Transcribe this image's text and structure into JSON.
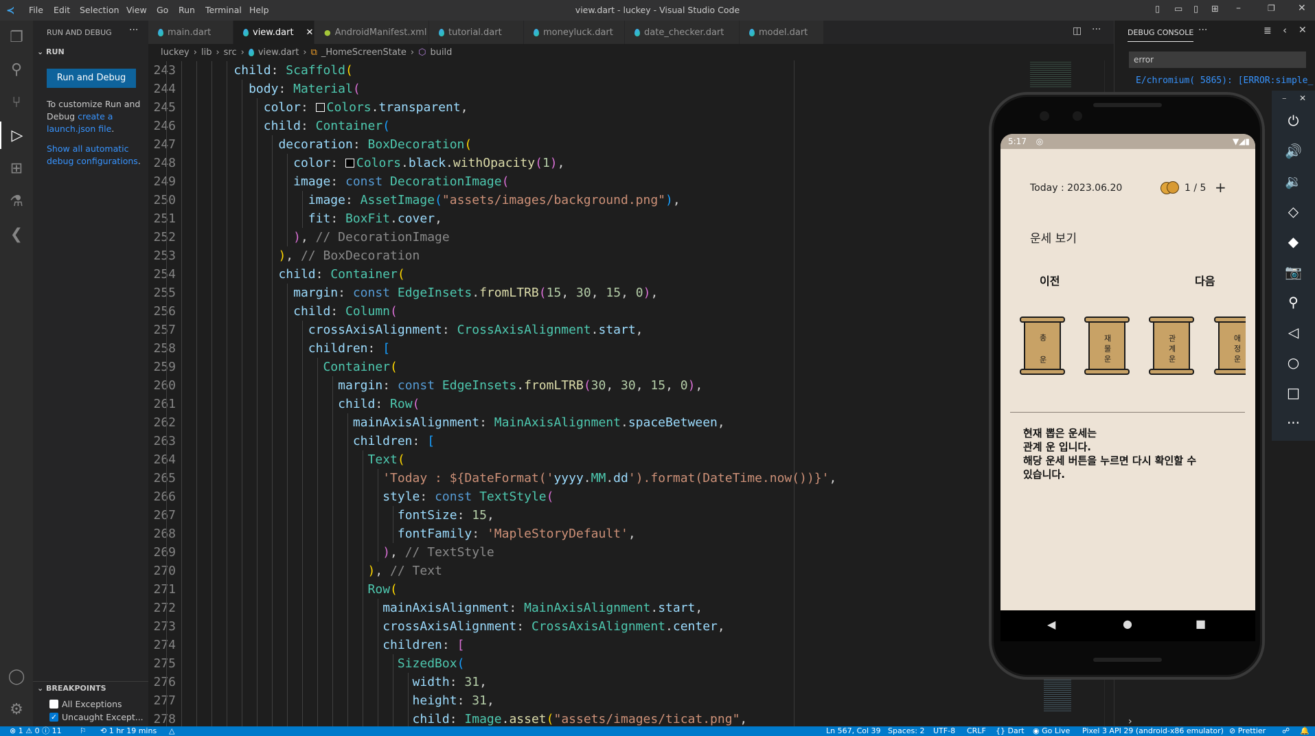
{
  "titlebar": {
    "menu": [
      "File",
      "Edit",
      "Selection",
      "View",
      "Go",
      "Run",
      "Terminal",
      "Help"
    ],
    "title": "view.dart - luckey - Visual Studio Code"
  },
  "sidebar": {
    "header": "RUN AND DEBUG",
    "section": "RUN",
    "run_button": "Run and Debug",
    "help_text": "To customize Run and Debug",
    "help_link": "create a launch.json file",
    "help_period": ".",
    "show_all_link": "Show all automatic debug configurations",
    "show_all_period": ".",
    "breakpoints_header": "BREAKPOINTS",
    "breakpoints": [
      {
        "label": "All Exceptions",
        "checked": false
      },
      {
        "label": "Uncaught Except...",
        "checked": true
      }
    ]
  },
  "tabs": [
    {
      "label": "main.dart",
      "icon": "dart"
    },
    {
      "label": "view.dart",
      "icon": "dart",
      "active": true
    },
    {
      "label": "AndroidManifest.xml",
      "icon": "android"
    },
    {
      "label": "tutorial.dart",
      "icon": "dart"
    },
    {
      "label": "moneyluck.dart",
      "icon": "dart"
    },
    {
      "label": "date_checker.dart",
      "icon": "dart"
    },
    {
      "label": "model.dart",
      "icon": "dart"
    }
  ],
  "breadcrumb": [
    "luckey",
    "lib",
    "src",
    "view.dart",
    "_HomeScreenState",
    "build"
  ],
  "code": [
    {
      "n": 243,
      "text": "          child: Scaffold("
    },
    {
      "n": 244,
      "text": "            body: Material("
    },
    {
      "n": 245,
      "text": "              color: Colors.transparent,",
      "swatch": "transparent"
    },
    {
      "n": 246,
      "text": "              child: Container("
    },
    {
      "n": 247,
      "text": "                decoration: BoxDecoration("
    },
    {
      "n": 248,
      "text": "                  color: Colors.black.withOpacity(1),",
      "swatch": "#000000"
    },
    {
      "n": 249,
      "text": "                  image: const DecorationImage("
    },
    {
      "n": 250,
      "text": "                    image: AssetImage(\"assets/images/background.png\"),"
    },
    {
      "n": 251,
      "text": "                    fit: BoxFit.cover,"
    },
    {
      "n": 252,
      "text": "                  ), // DecorationImage"
    },
    {
      "n": 253,
      "text": "                ), // BoxDecoration"
    },
    {
      "n": 254,
      "text": "                child: Container("
    },
    {
      "n": 255,
      "text": "                  margin: const EdgeInsets.fromLTRB(15, 30, 15, 0),"
    },
    {
      "n": 256,
      "text": "                  child: Column("
    },
    {
      "n": 257,
      "text": "                    crossAxisAlignment: CrossAxisAlignment.start,"
    },
    {
      "n": 258,
      "text": "                    children: ["
    },
    {
      "n": 259,
      "text": "                      Container("
    },
    {
      "n": 260,
      "text": "                        margin: const EdgeInsets.fromLTRB(30, 30, 15, 0),"
    },
    {
      "n": 261,
      "text": "                        child: Row("
    },
    {
      "n": 262,
      "text": "                          mainAxisAlignment: MainAxisAlignment.spaceBetween,"
    },
    {
      "n": 263,
      "text": "                          children: ["
    },
    {
      "n": 264,
      "text": "                            Text("
    },
    {
      "n": 265,
      "text": "                              'Today : ${DateFormat('yyyy.MM.dd').format(DateTime.now())}',"
    },
    {
      "n": 266,
      "text": "                              style: const TextStyle("
    },
    {
      "n": 267,
      "text": "                                fontSize: 15,"
    },
    {
      "n": 268,
      "text": "                                fontFamily: 'MapleStoryDefault',"
    },
    {
      "n": 269,
      "text": "                              ), // TextStyle"
    },
    {
      "n": 270,
      "text": "                            ), // Text"
    },
    {
      "n": 271,
      "text": "                            Row("
    },
    {
      "n": 272,
      "text": "                              mainAxisAlignment: MainAxisAlignment.start,"
    },
    {
      "n": 273,
      "text": "                              crossAxisAlignment: CrossAxisAlignment.center,"
    },
    {
      "n": 274,
      "text": "                              children: ["
    },
    {
      "n": 275,
      "text": "                                SizedBox("
    },
    {
      "n": 276,
      "text": "                                  width: 31,"
    },
    {
      "n": 277,
      "text": "                                  height: 31,"
    },
    {
      "n": 278,
      "text": "                                  child: Image.asset(\"assets/images/ticat.png\","
    }
  ],
  "debug_console": {
    "tab": "DEBUG CONSOLE",
    "filter_value": "error",
    "lines": [
      "E/chromium( 5865): [ERROR:simple_"
    ]
  },
  "phone": {
    "time": "5:17",
    "date_label": "Today : 2023.06.20",
    "ticket_count": "1 / 5",
    "add": "+",
    "section_title": "운세 보기",
    "prev": "이전",
    "next": "다음",
    "scrolls": [
      "총 운",
      "재물운",
      "관계운",
      "애정운"
    ],
    "message": [
      "현재 뽑은 운세는",
      "관계 운 입니다.",
      "해당 운세 버튼을 누르면 다시 확인할 수",
      "있습니다."
    ]
  },
  "emulator_tools": [
    "power",
    "volume-up",
    "volume-down",
    "rotate-left",
    "rotate-right",
    "camera",
    "zoom",
    "back",
    "home",
    "overview",
    "more"
  ],
  "statusbar": {
    "errors": "1",
    "warnings": "0",
    "infos": "11",
    "time_spent": "1 hr 19 mins",
    "position": "Ln 567, Col 39",
    "spaces": "Spaces: 2",
    "encoding": "UTF-8",
    "eol": "CRLF",
    "language": "Dart",
    "golive": "Go Live",
    "device": "Pixel 3 API 29 (android-x86 emulator)",
    "prettier": "Prettier"
  },
  "colors": {
    "accent": "#007acc",
    "button": "#0e639c",
    "link": "#3794ff",
    "scroll": "#c8a266"
  }
}
